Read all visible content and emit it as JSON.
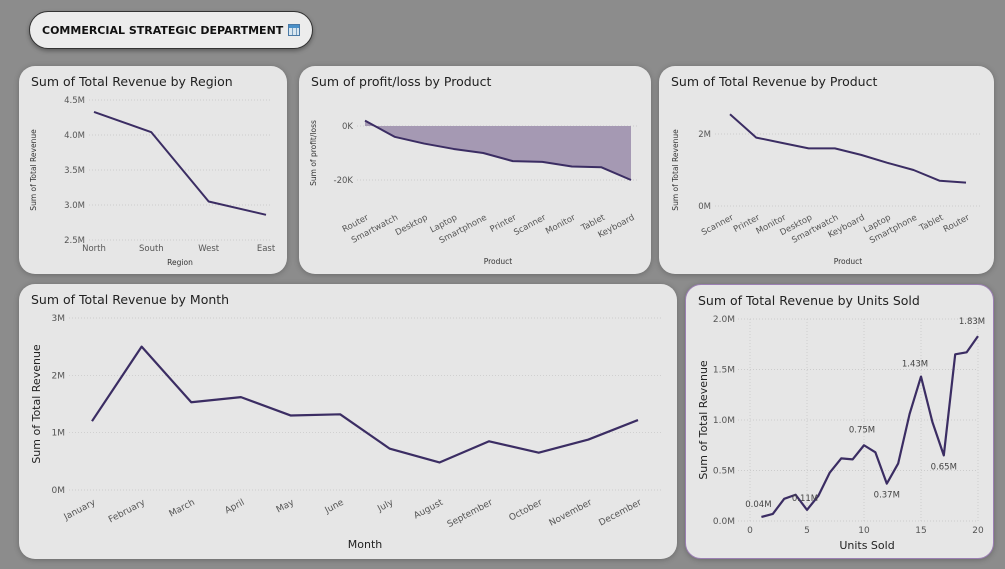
{
  "header": {
    "title": "COMMERCIAL STRATEGIC DEPARTMENT"
  },
  "colors": {
    "line": "#3b2d63",
    "area": "#a599b3",
    "card": "#e6e6e6",
    "background": "#8c8c8c"
  },
  "charts": [
    {
      "title": "Sum of Total Revenue by Region",
      "xlabel": "Region",
      "ylabel": "Sum of Total Revenue",
      "y_ticks": [
        "4.5M",
        "4.0M",
        "3.5M",
        "3.0M",
        "2.5M"
      ]
    },
    {
      "title": "Sum of profit/loss by Product",
      "xlabel": "Product",
      "ylabel": "Sum of profit/loss",
      "y_ticks": [
        "0K",
        "-20K"
      ]
    },
    {
      "title": "Sum of Total Revenue by Product",
      "xlabel": "Product",
      "ylabel": "Sum of Total Revenue",
      "y_ticks": [
        "2M",
        "0M"
      ]
    },
    {
      "title": "Sum of Total Revenue by Month",
      "xlabel": "Month",
      "ylabel": "Sum of Total Revenue",
      "y_ticks": [
        "3M",
        "2M",
        "1M",
        "0M"
      ]
    },
    {
      "title": "Sum of Total Revenue by Units Sold",
      "xlabel": "Units Sold",
      "ylabel": "Sum of Total Revenue",
      "y_ticks": [
        "2.0M",
        "1.5M",
        "1.0M",
        "0.5M",
        "0.0M"
      ],
      "x_ticks": [
        "0",
        "5",
        "10",
        "15",
        "20"
      ]
    }
  ],
  "chart_data": [
    {
      "type": "line",
      "categories": [
        "North",
        "South",
        "West",
        "East"
      ],
      "values": [
        4.33,
        4.04,
        3.05,
        2.86
      ],
      "ylim": [
        2.5,
        4.5
      ],
      "unit": "M"
    },
    {
      "type": "area",
      "categories": [
        "Router",
        "Smartwatch",
        "Desktop",
        "Laptop",
        "Smartphone",
        "Printer",
        "Scanner",
        "Monitor",
        "Tablet",
        "Keyboard"
      ],
      "values": [
        2,
        -4,
        -6.5,
        -8.5,
        -10,
        -13,
        -13.3,
        -15,
        -15.3,
        -20
      ],
      "ylim": [
        -20,
        0
      ],
      "unit": "K"
    },
    {
      "type": "line",
      "categories": [
        "Scanner",
        "Printer",
        "Monitor",
        "Desktop",
        "Smartwatch",
        "Keyboard",
        "Laptop",
        "Smartphone",
        "Tablet",
        "Router"
      ],
      "values": [
        2.55,
        1.9,
        1.75,
        1.6,
        1.6,
        1.42,
        1.2,
        1.0,
        0.7,
        0.65
      ],
      "ylim": [
        0,
        2
      ],
      "unit": "M"
    },
    {
      "type": "line",
      "categories": [
        "January",
        "February",
        "March",
        "April",
        "May",
        "June",
        "July",
        "August",
        "September",
        "October",
        "November",
        "December"
      ],
      "values": [
        1.2,
        2.5,
        1.53,
        1.62,
        1.3,
        1.32,
        0.72,
        0.48,
        0.85,
        0.65,
        0.88,
        1.22
      ],
      "ylim": [
        0,
        3
      ],
      "unit": "M"
    },
    {
      "type": "line",
      "x": [
        1,
        2,
        3,
        4,
        5,
        6,
        7,
        8,
        9,
        10,
        11,
        12,
        13,
        14,
        15,
        16,
        17,
        18,
        19,
        20
      ],
      "values": [
        0.04,
        0.07,
        0.22,
        0.26,
        0.11,
        0.25,
        0.48,
        0.62,
        0.61,
        0.75,
        0.68,
        0.37,
        0.57,
        1.06,
        1.43,
        0.98,
        0.65,
        1.65,
        1.67,
        1.83
      ],
      "ylim": [
        0,
        2
      ],
      "xlim": [
        0,
        20
      ],
      "data_labels": [
        {
          "x": 1,
          "text": "0.04M"
        },
        {
          "x": 5,
          "text": "0.11M"
        },
        {
          "x": 10,
          "text": "0.75M"
        },
        {
          "x": 12,
          "text": "0.37M"
        },
        {
          "x": 15,
          "text": "1.43M"
        },
        {
          "x": 17,
          "text": "0.65M"
        },
        {
          "x": 20,
          "text": "1.83M"
        }
      ],
      "unit": "M"
    }
  ]
}
